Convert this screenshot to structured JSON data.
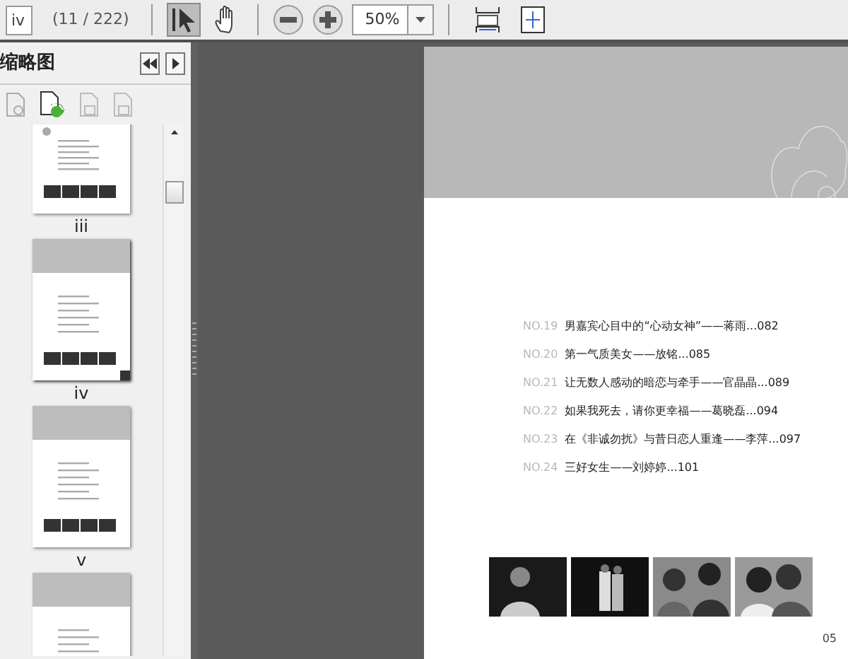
{
  "toolbar": {
    "page_field": "iv",
    "page_count": "(11 / 222)",
    "tools": [
      {
        "kind": "select",
        "selected": true
      },
      {
        "kind": "hand",
        "selected": false
      }
    ],
    "zoom": "50%"
  },
  "sidebar": {
    "title": "缩略图",
    "thumbnails": [
      {
        "kind": "toc",
        "label": "iii",
        "selected": false
      },
      {
        "kind": "banner",
        "label": "iv",
        "selected": true
      },
      {
        "kind": "banner",
        "label": "v",
        "selected": false
      },
      {
        "kind": "banner",
        "selected": false
      }
    ]
  },
  "page": {
    "toc": [
      {
        "number": "NO.19",
        "title": "男嘉宾心目中的“心动女神”——蒋雨...082"
      },
      {
        "number": "NO.20",
        "title": "第一气质美女——放铭...085"
      },
      {
        "number": "NO.21",
        "title": "让无数人感动的暗恋与牵手——官晶晶...089"
      },
      {
        "number": "NO.22",
        "title": "如果我死去，请你更幸福——葛晓磊...094"
      },
      {
        "number": "NO.23",
        "title": "在《非诚勿扰》与昔日恋人重逢——李萍...097"
      },
      {
        "number": "NO.24",
        "title": "三好女生——刘婷婷...101"
      }
    ],
    "page_number": "05"
  }
}
